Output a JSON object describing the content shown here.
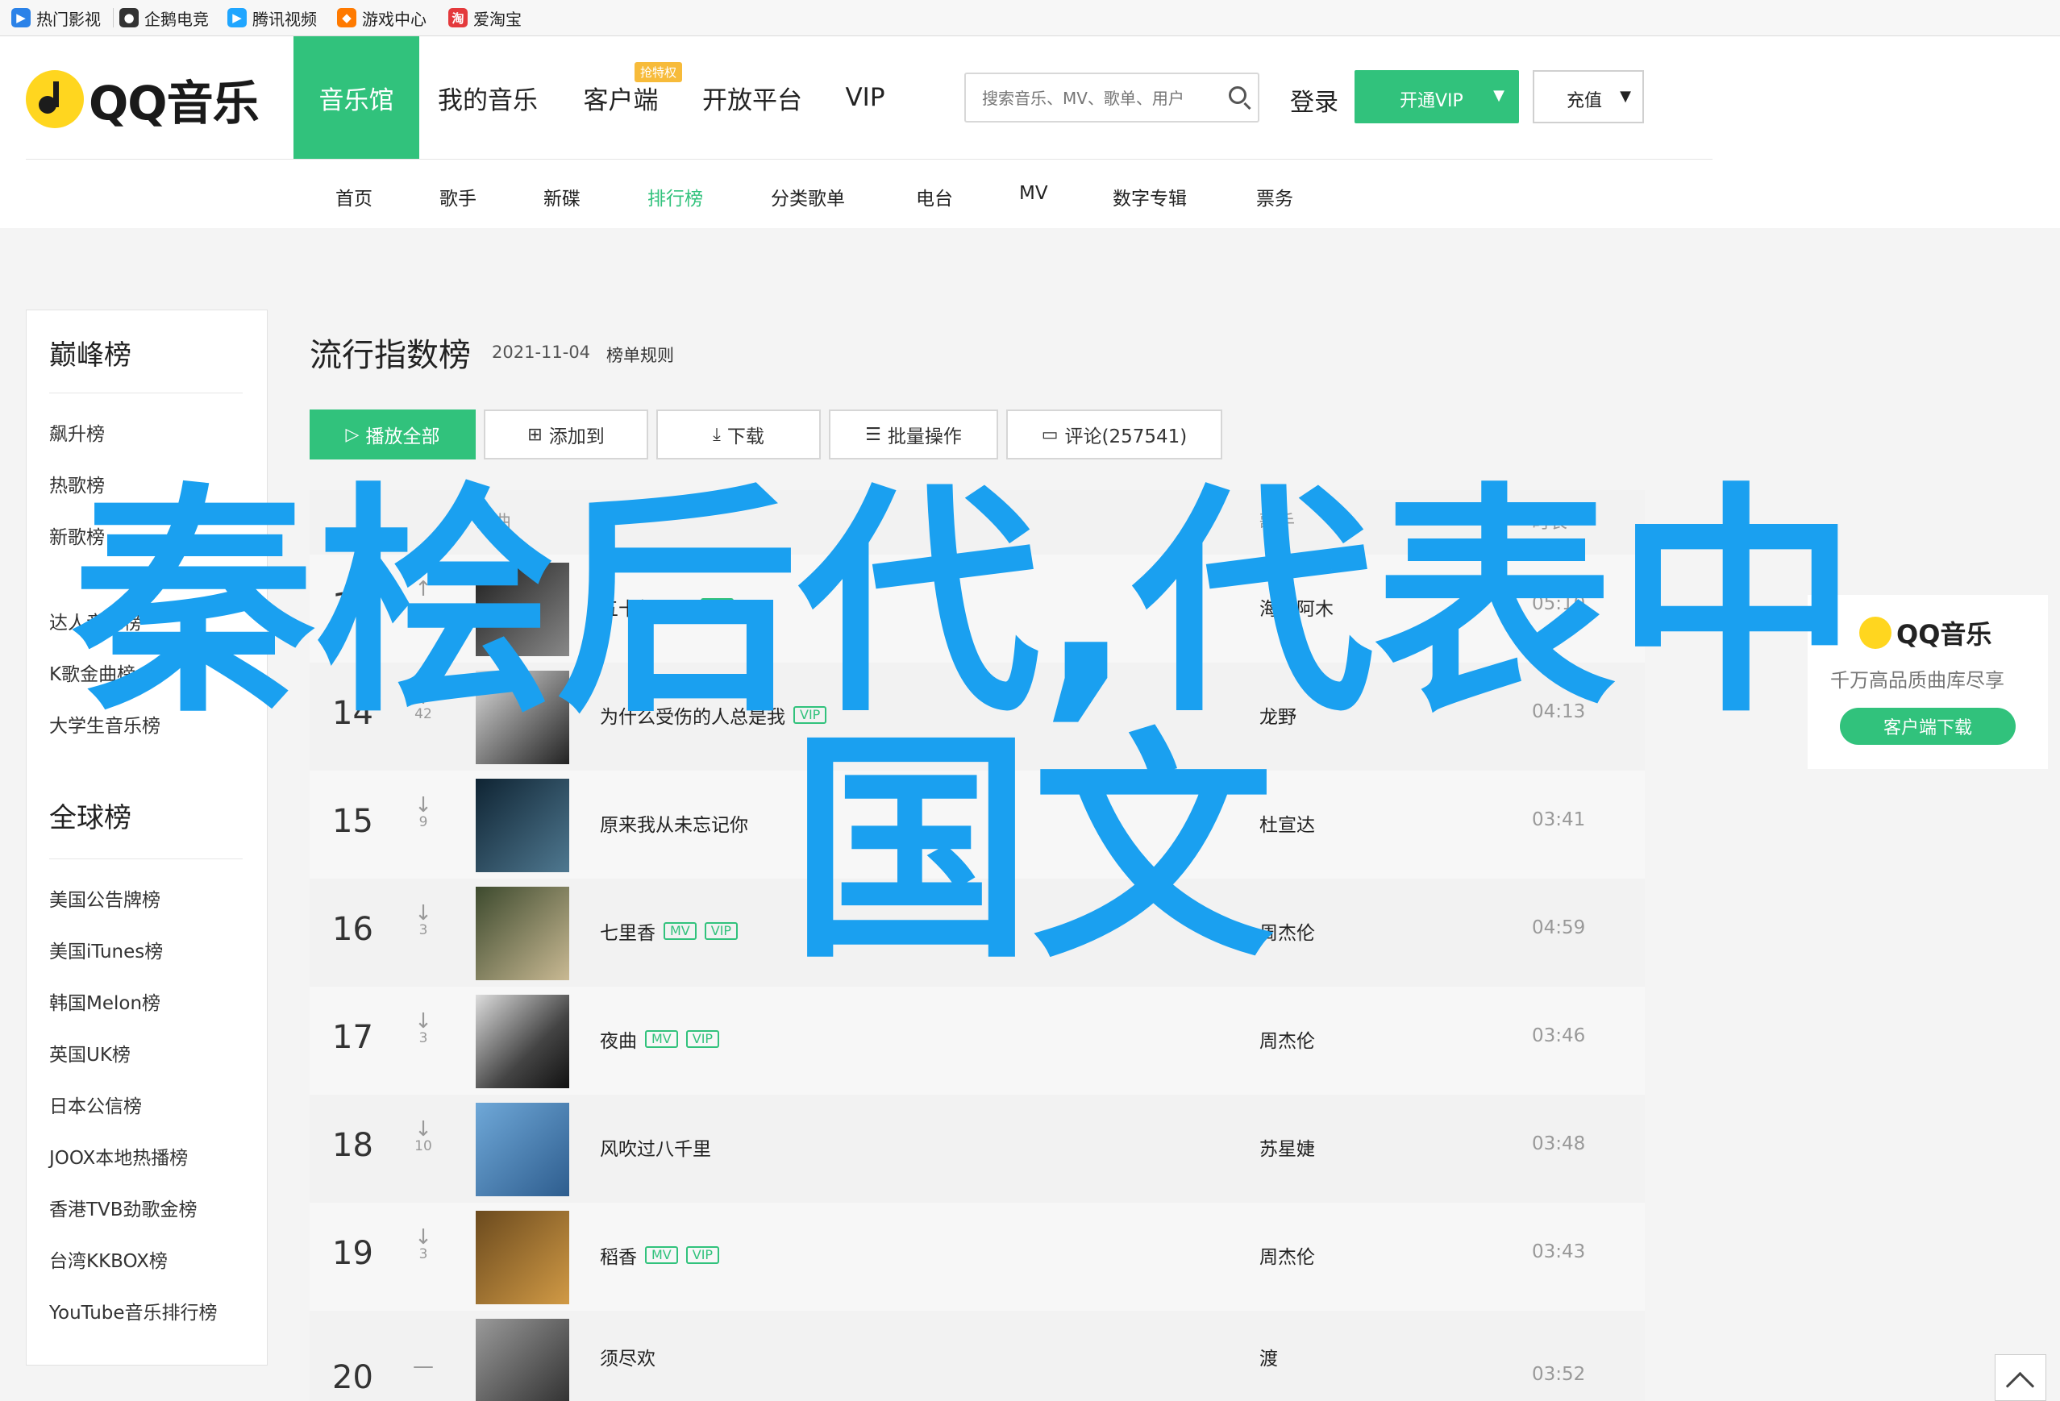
{
  "bookmarks": [
    {
      "label": "热门影视",
      "icon": "video-icon",
      "color": "#2b82e8"
    },
    {
      "label": "企鹅电竞",
      "icon": "penguin-icon",
      "color": "#333333"
    },
    {
      "label": "腾讯视频",
      "icon": "play-icon",
      "color": "#20a6ff"
    },
    {
      "label": "游戏中心",
      "icon": "game-icon",
      "color": "#ff7a00"
    },
    {
      "label": "爱淘宝",
      "icon": "taobao-icon",
      "color": "#e4393c"
    }
  ],
  "header": {
    "logo_text": "QQ音乐",
    "nav": [
      "音乐馆",
      "我的音乐",
      "客户端",
      "开放平台",
      "VIP"
    ],
    "badge": "抢特权",
    "search_placeholder": "搜索音乐、MV、歌单、用户",
    "login": "登录",
    "vip_label": "开通VIP",
    "vip_caret": "▼",
    "charge_label": "充值",
    "charge_caret": "▼",
    "subnav": [
      "首页",
      "歌手",
      "新碟",
      "排行榜",
      "分类歌单",
      "电台",
      "MV",
      "数字专辑",
      "票务"
    ]
  },
  "sidebar": {
    "peak_title": "巅峰榜",
    "peak_items": [
      "飙升榜",
      "热歌榜",
      "新歌榜",
      "",
      "达人音乐榜",
      "K歌金曲榜",
      "大学生音乐榜"
    ],
    "global_title": "全球榜",
    "global_items": [
      "美国公告牌榜",
      "美国iTunes榜",
      "韩国Melon榜",
      "英国UK榜",
      "日本公信榜",
      "JOOX本地热播榜",
      "香港TVB劲歌金榜",
      "台湾KKBOX榜",
      "YouTube音乐排行榜"
    ]
  },
  "main": {
    "title": "流行指数榜",
    "date": "2021-11-04",
    "rule": "榜单规则",
    "buttons": {
      "play_all": "播放全部",
      "add_to": "添加到",
      "download": "下载",
      "batch": "批量操作",
      "comment": "评论(257541)"
    },
    "columns": {
      "song": "歌曲",
      "singer": "歌手",
      "duration": "时长"
    },
    "rows": [
      {
        "rank": "13",
        "trend": "↑",
        "change": "",
        "song": "五十年以后",
        "tags": [
          "MV"
        ],
        "singer": "海来阿木",
        "duration": "05:10"
      },
      {
        "rank": "14",
        "trend": "↑",
        "change": "42",
        "song": "为什么受伤的人总是我",
        "tags": [
          "VIP"
        ],
        "singer": "龙野",
        "duration": "04:13"
      },
      {
        "rank": "15",
        "trend": "↓",
        "change": "9",
        "song": "原来我从未忘记你",
        "tags": [],
        "singer": "杜宣达",
        "duration": "03:41"
      },
      {
        "rank": "16",
        "trend": "↓",
        "change": "3",
        "song": "七里香",
        "tags": [
          "MV",
          "VIP"
        ],
        "singer": "周杰伦",
        "duration": "04:59"
      },
      {
        "rank": "17",
        "trend": "↓",
        "change": "3",
        "song": "夜曲",
        "tags": [
          "MV",
          "VIP"
        ],
        "singer": "周杰伦",
        "duration": "03:46"
      },
      {
        "rank": "18",
        "trend": "↓",
        "change": "10",
        "song": "风吹过八千里",
        "tags": [],
        "singer": "苏星婕",
        "duration": "03:48"
      },
      {
        "rank": "19",
        "trend": "↓",
        "change": "3",
        "song": "稻香",
        "tags": [
          "MV",
          "VIP"
        ],
        "singer": "周杰伦",
        "duration": "03:43"
      },
      {
        "rank": "20",
        "trend": "—",
        "change": "",
        "song": "须尽欢",
        "tags": [],
        "singer": "渡",
        "duration": "03:52"
      }
    ]
  },
  "ad": {
    "logo": "QQ音乐",
    "subtitle": "千万高品质曲库尽享",
    "button": "客户端下载"
  },
  "overlay": {
    "line1": "秦桧后代,代表中",
    "line2": "国文"
  }
}
